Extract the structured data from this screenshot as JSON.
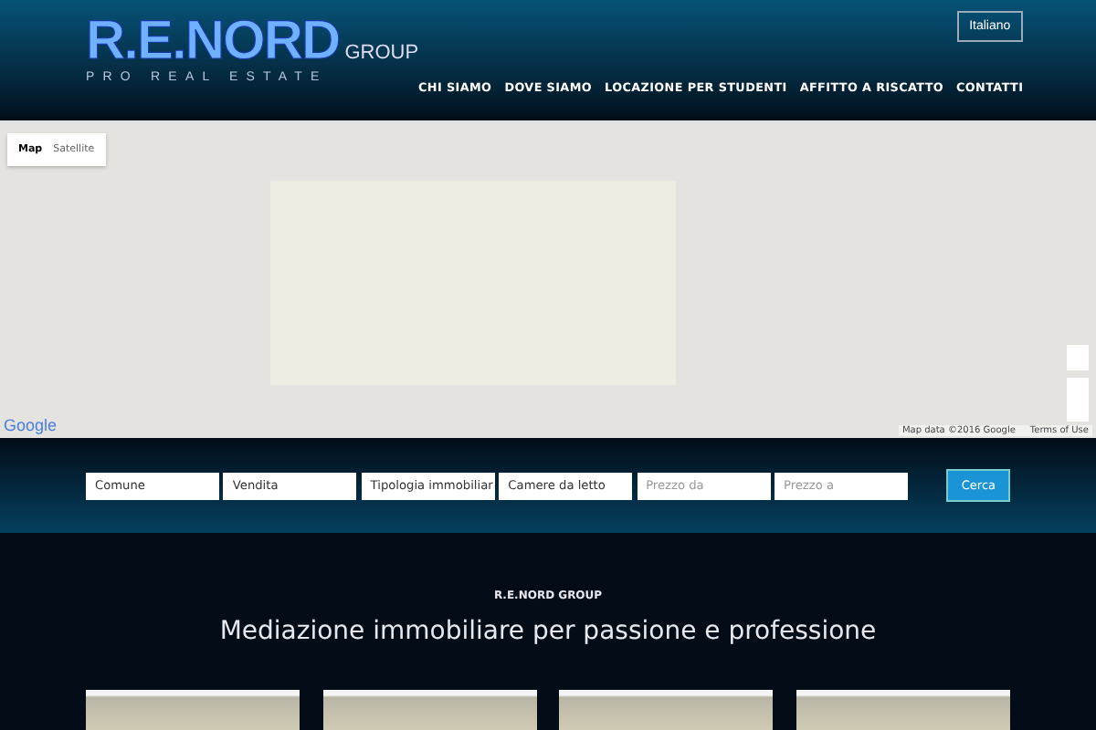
{
  "header": {
    "logo": {
      "wordmark": "R.E.NORD",
      "suffix": "GROUP",
      "tagline": "PRO REAL ESTATE"
    },
    "language": "Italiano",
    "nav": [
      "CHI SIAMO",
      "DOVE SIAMO",
      "LOCAZIONE PER STUDENTI",
      "AFFITTO A RISCATTO",
      "CONTATTI"
    ]
  },
  "map": {
    "types": [
      {
        "label": "Map",
        "selected": true
      },
      {
        "label": "Satellite",
        "selected": false
      }
    ],
    "brand": "Google",
    "attribution": "Map data ©2016 Google",
    "terms": "Terms of Use"
  },
  "search": {
    "fields": [
      {
        "kind": "select",
        "value": "Comune"
      },
      {
        "kind": "select",
        "value": "Vendita"
      },
      {
        "kind": "select",
        "value": "Tipologia immobiliar"
      },
      {
        "kind": "select",
        "value": "Camere da letto"
      },
      {
        "kind": "input",
        "placeholder": "Prezzo da"
      },
      {
        "kind": "input",
        "placeholder": "Prezzo a"
      }
    ],
    "button": "Cerca"
  },
  "intro": {
    "eyebrow": "R.E.NORD GROUP",
    "title": "Mediazione immobiliare per passione e professione"
  },
  "cards": [
    {
      "kind": "photo"
    },
    {
      "kind": "photo"
    },
    {
      "kind": "photo"
    },
    {
      "kind": "photo"
    }
  ]
}
